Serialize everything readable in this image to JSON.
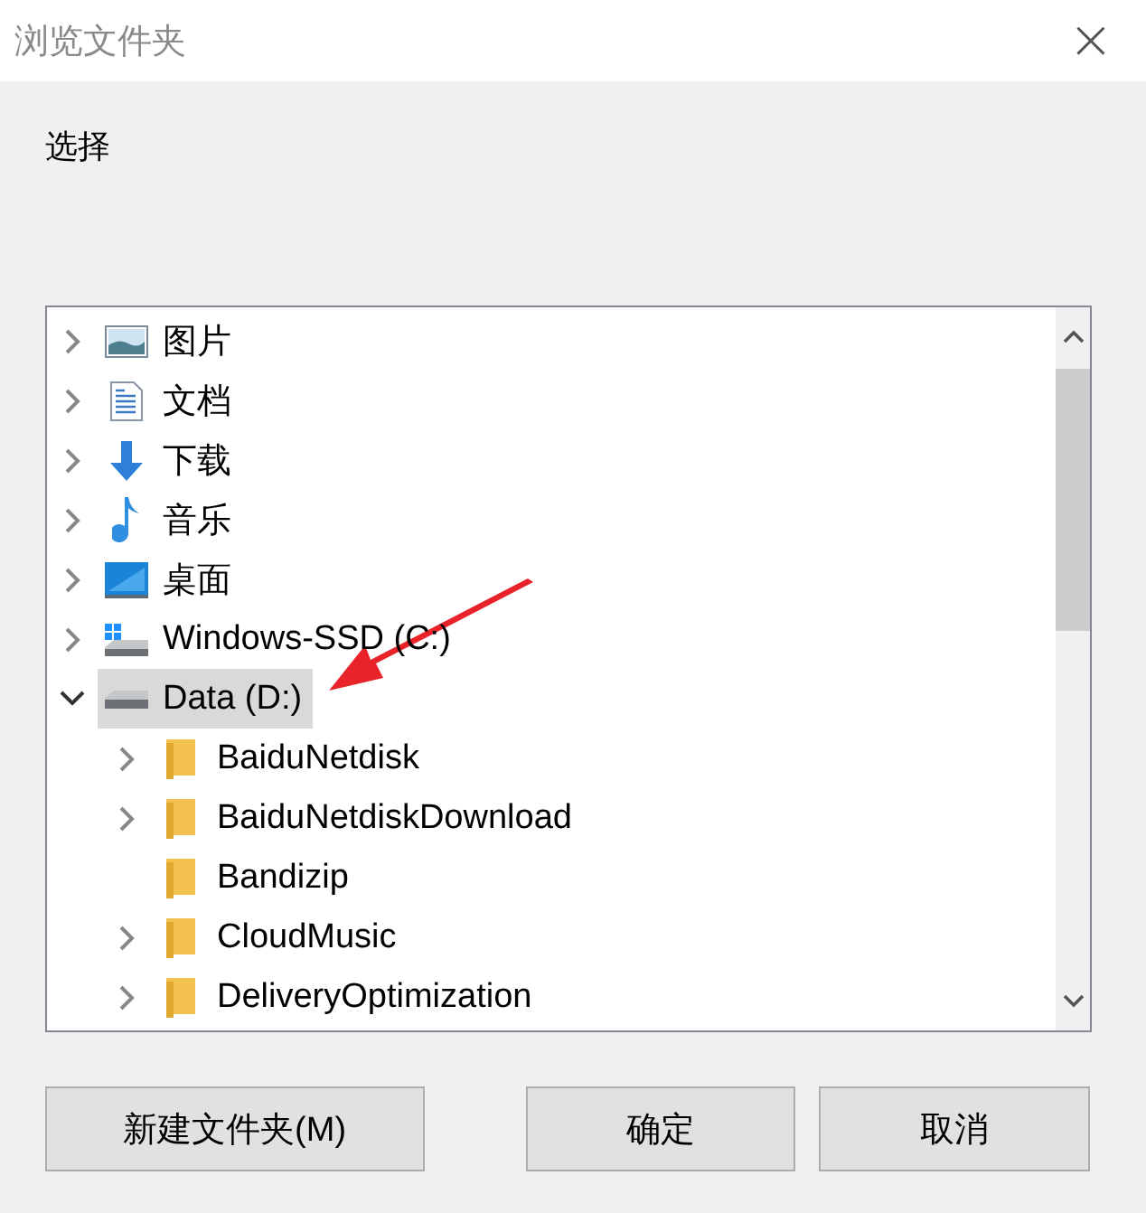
{
  "window": {
    "title": "浏览文件夹",
    "close": "×"
  },
  "prompt": "选择",
  "tree": [
    {
      "label": "图片",
      "kind": "pictures",
      "expanded": false,
      "selected": false
    },
    {
      "label": "文档",
      "kind": "documents",
      "expanded": false,
      "selected": false
    },
    {
      "label": "下载",
      "kind": "downloads",
      "expanded": false,
      "selected": false
    },
    {
      "label": "音乐",
      "kind": "music",
      "expanded": false,
      "selected": false
    },
    {
      "label": "桌面",
      "kind": "desktop",
      "expanded": false,
      "selected": false
    },
    {
      "label": "Windows-SSD (C:)",
      "kind": "system-drive",
      "expanded": false,
      "selected": false
    },
    {
      "label": "Data (D:)",
      "kind": "drive",
      "expanded": true,
      "selected": true,
      "children": [
        {
          "label": "BaiduNetdisk",
          "kind": "folder",
          "expanded": false,
          "selected": false
        },
        {
          "label": "BaiduNetdiskDownload",
          "kind": "folder",
          "expanded": false,
          "selected": false
        },
        {
          "label": "Bandizip",
          "kind": "folder",
          "selected": false
        },
        {
          "label": "CloudMusic",
          "kind": "folder",
          "expanded": false,
          "selected": false
        },
        {
          "label": "DeliveryOptimization",
          "kind": "folder",
          "expanded": false,
          "selected": false
        }
      ]
    }
  ],
  "buttons": [
    "新建文件夹(M)",
    "确定",
    "取消"
  ]
}
